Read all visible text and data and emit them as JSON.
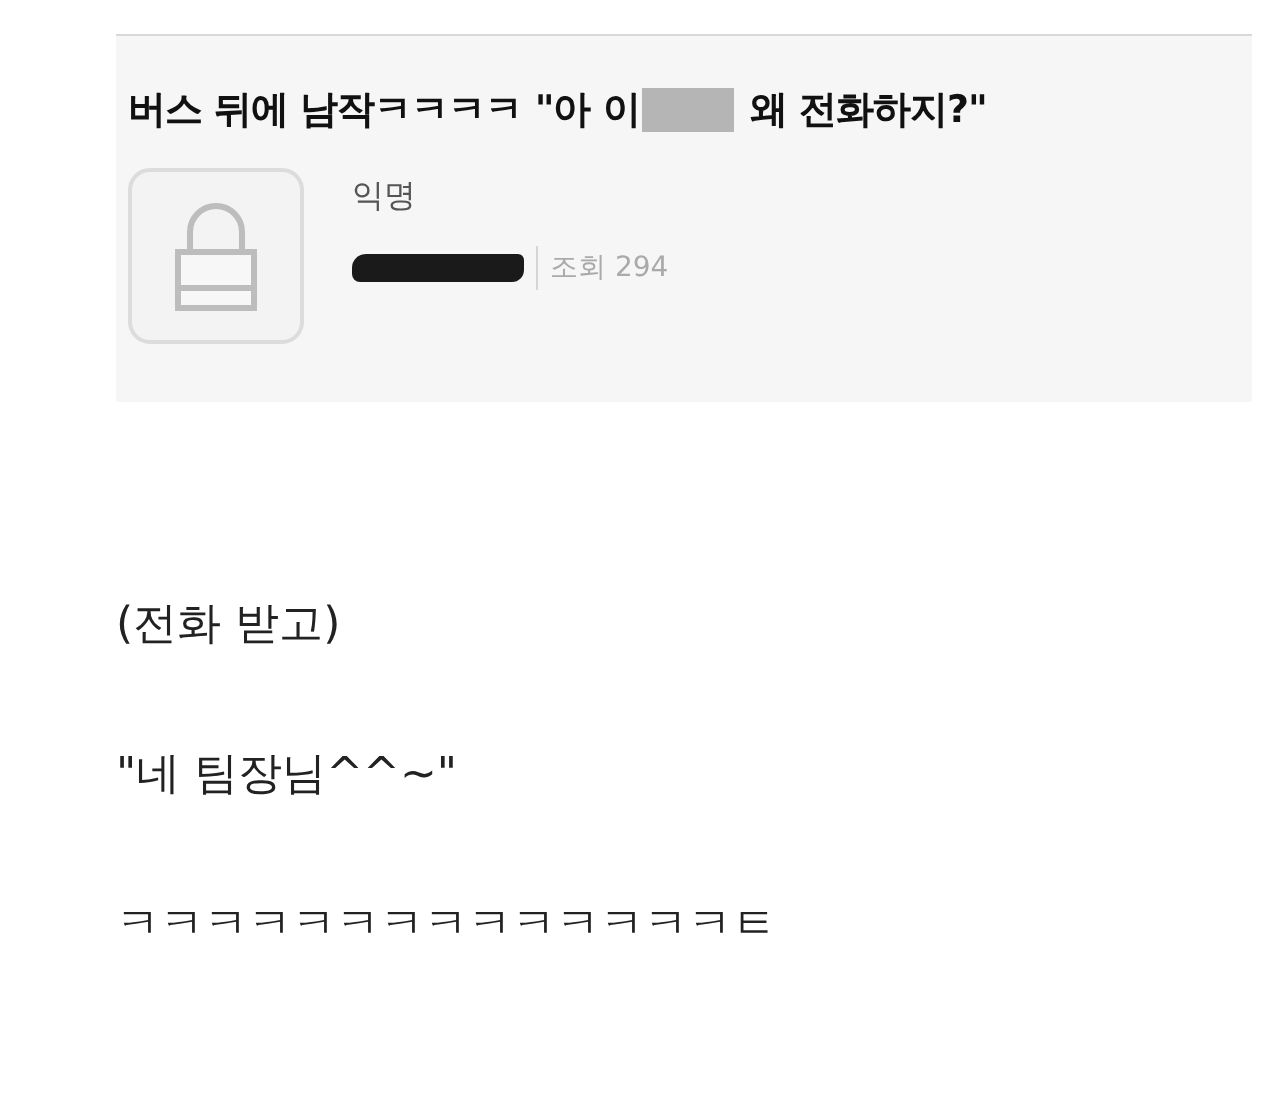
{
  "post": {
    "title_before": "버스 뒤에 남작ㅋㅋㅋㅋ \"아 이",
    "title_censored": true,
    "title_after": "왜 전화하지?\"",
    "author": "익명",
    "date_redacted": true,
    "views": "조회 294"
  },
  "body": [
    "(전화 받고)",
    "\"네 팀장님^^~\"",
    "ㅋㅋㅋㅋㅋㅋㅋㅋㅋㅋㅋㅋㅋㅋㅌ"
  ]
}
